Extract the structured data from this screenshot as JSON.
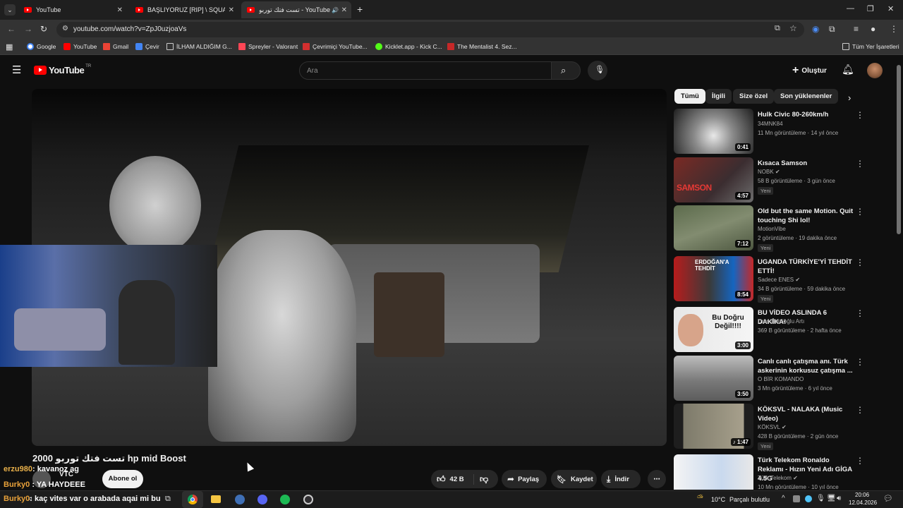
{
  "tabs": [
    {
      "title": "YouTube"
    },
    {
      "title": "BAŞLIYORUZ [RIP] \\ SQUAD TÜ"
    },
    {
      "title": "تست فتك توربو - YouTube"
    }
  ],
  "address": {
    "url": "youtube.com/watch?v=ZpJ0uzjoaVs"
  },
  "bookmarks": [
    {
      "label": "Google"
    },
    {
      "label": "YouTube"
    },
    {
      "label": "Gmail"
    },
    {
      "label": "Çevir"
    },
    {
      "label": "İLHAM ALDIĞIM G..."
    },
    {
      "label": "Spreyler - Valorant"
    },
    {
      "label": "Çevrimiçi YouTube..."
    },
    {
      "label": "Kicklet.app - Kick C..."
    },
    {
      "label": "The Mentalist 4. Sez..."
    }
  ],
  "bookmarks_all": "Tüm Yer İşaretleri",
  "yt": {
    "logo": "YouTube",
    "logo_sup": "TR",
    "search_placeholder": "Ara",
    "create_label": "Oluştur"
  },
  "chips": [
    "Tümü",
    "İlgili",
    "Size özel",
    "Son yüklenenler"
  ],
  "recommendations": [
    {
      "title": "Hulk Civic 80-260km/h",
      "channel": "34MNK84",
      "stats": "11 Mn görüntüleme · 14 yıl önce",
      "duration": "0:41",
      "is_new": ""
    },
    {
      "title": "Kısaca Samson",
      "channel": "NOBK",
      "stats": "58 B görüntüleme · 3 gün önce",
      "duration": "4:57",
      "is_new": "Yeni",
      "thumb_text": "SAMSON"
    },
    {
      "title": "Old but the same Motion. Quit touching Shi lol!",
      "channel": "MotionVibe",
      "stats": "2 görüntüleme · 19 dakika önce",
      "duration": "7:12",
      "is_new": "Yeni"
    },
    {
      "title": "UGANDA TÜRKİYE'Yİ TEHDİT ETTİ!",
      "channel": "Sadece ENES",
      "stats": "34 B görüntüleme · 59 dakika önce",
      "duration": "8:54",
      "is_new": "Yeni",
      "thumb_text": "ERDOĞAN'A TEHDİT"
    },
    {
      "title": "BU VİDEO ASLINDA 6 DAKİKA!",
      "channel": "Uras Benlioğlu Artı",
      "stats": "369 B görüntüleme · 2 hafta önce",
      "duration": "3:00",
      "is_new": "",
      "thumb_text": "Bu Doğru Değil!!!!"
    },
    {
      "title": "Canlı canlı çatışma anı. Türk askerinin korkusuz çatışma ...",
      "channel": "O BİR KOMANDO",
      "stats": "3 Mn görüntüleme · 6 yıl önce",
      "duration": "3:50",
      "is_new": ""
    },
    {
      "title": "KÖKSVL - NALAKA (Music Video)",
      "channel": "KÖKSVL",
      "stats": "428 B görüntüleme · 2 gün önce",
      "duration": "1:47",
      "is_new": "Yeni"
    },
    {
      "title": "Türk Telekom Ronaldo Reklamı - Hızın Yeni Adı GİGA 4.5G",
      "channel": "Türk Telekom",
      "stats": "10 Mn görüntüleme · 10 yıl önce",
      "duration": "",
      "is_new": ""
    }
  ],
  "video": {
    "title": "2000 تست فتك توربو hp mid Boost",
    "channel": "VTC",
    "subscribe": "Abone ol",
    "likes": "42 B",
    "share": "Paylaş",
    "save": "Kaydet",
    "download": "İndir"
  },
  "chat_overlay": [
    {
      "user": "erzu980",
      "msg": "kavanoz ag"
    },
    {
      "user": "Burky0",
      "msg": "YA HAYDEEE"
    },
    {
      "user": "Burky0",
      "msg": "kaç vites var o arabada aqai mi bu"
    }
  ],
  "taskbar": {
    "temp": "10°C",
    "weather": "Parçalı bulutlu",
    "time": "20:06",
    "date": "12.04.2026"
  },
  "colors": {
    "yt_red": "#ff0000",
    "bg": "#0f0f0f",
    "chip_bg": "#272727"
  }
}
